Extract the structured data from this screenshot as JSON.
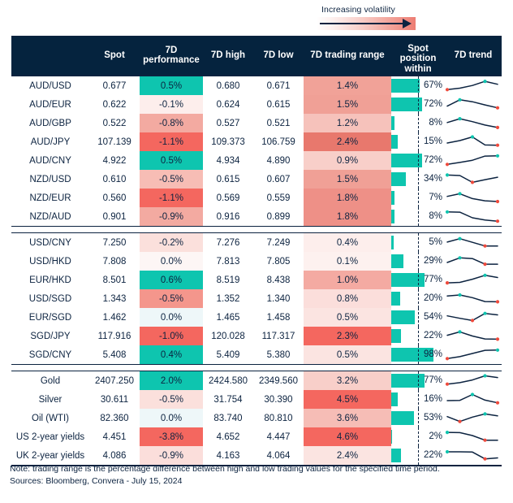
{
  "legend": {
    "volatility_label": "Increasing volatility",
    "gradient_from": "#ffffff",
    "gradient_to": "#ed7d73"
  },
  "colors": {
    "header_bg": "#05233E",
    "text": "#0c2340",
    "teal": "#0ec5af",
    "red_strong": "#f4675f",
    "grid_line": "#0c2340"
  },
  "header": {
    "blank": "",
    "columns": [
      "Spot",
      "7D performance",
      "7D high",
      "7D low",
      "7D trading range",
      "Spot position within range",
      "7D trend"
    ]
  },
  "sections": [
    {
      "name": "antipodean-pairs",
      "rows": [
        {
          "label": "AUD/USD",
          "spot": "0.677",
          "perf": "0.5%",
          "perf_val": 0.5,
          "perf_bg": "#0ec5af",
          "high": "0.680",
          "low": "0.671",
          "range": "1.4%",
          "range_bg": "#f1a298",
          "pos": "67%",
          "pos_val": 67,
          "spark": [
            0.18,
            0.3,
            0.52,
            0.86,
            0.62
          ],
          "spark_start": "low",
          "spark_peak_index": 3
        },
        {
          "label": "AUD/EUR",
          "spot": "0.622",
          "perf": "-0.1%",
          "perf_val": -0.1,
          "perf_bg": "#fdeeec",
          "high": "0.624",
          "low": "0.615",
          "range": "1.5%",
          "range_bg": "#f0a096",
          "pos": "72%",
          "pos_val": 72,
          "spark": [
            0.36,
            0.88,
            0.72,
            0.46,
            0.22
          ],
          "spark_start": "high",
          "spark_peak_index": 1
        },
        {
          "label": "AUD/GBP",
          "spot": "0.522",
          "perf": "-0.8%",
          "perf_val": -0.8,
          "perf_bg": "#f3aaa1",
          "high": "0.527",
          "low": "0.521",
          "range": "1.2%",
          "range_bg": "#f6c2bb",
          "pos": "8%",
          "pos_val": 8,
          "spark": [
            0.55,
            0.86,
            0.62,
            0.34,
            0.14
          ],
          "spark_start": "high",
          "spark_peak_index": 1
        },
        {
          "label": "AUD/JPY",
          "spot": "107.139",
          "perf": "-1.1%",
          "perf_val": -1.1,
          "perf_bg": "#f4675f",
          "high": "109.373",
          "low": "106.759",
          "range": "2.4%",
          "range_bg": "#e8786d",
          "pos": "15%",
          "pos_val": 15,
          "spark": [
            0.4,
            0.6,
            0.9,
            0.24,
            0.22
          ],
          "spark_start": "mid",
          "spark_peak_index": 2
        },
        {
          "label": "AUD/CNY",
          "spot": "4.922",
          "perf": "0.5%",
          "perf_val": 0.5,
          "perf_bg": "#0ec5af",
          "high": "4.934",
          "low": "4.890",
          "range": "0.9%",
          "range_bg": "#f8cfc9",
          "pos": "72%",
          "pos_val": 72,
          "spark": [
            0.18,
            0.34,
            0.52,
            0.86,
            0.88
          ],
          "spark_start": "low",
          "spark_peak_index": 4
        },
        {
          "label": "NZD/USD",
          "spot": "0.610",
          "perf": "-0.5%",
          "perf_val": -0.5,
          "perf_bg": "#f7bdb5",
          "high": "0.615",
          "low": "0.607",
          "range": "1.5%",
          "range_bg": "#f0a096",
          "pos": "34%",
          "pos_val": 34,
          "spark": [
            0.84,
            0.8,
            0.24,
            0.46,
            0.66
          ],
          "spark_start": "high",
          "spark_peak_index": 0
        },
        {
          "label": "NZD/EUR",
          "spot": "0.560",
          "perf": "-1.1%",
          "perf_val": -1.1,
          "perf_bg": "#f4675f",
          "high": "0.569",
          "low": "0.559",
          "range": "1.8%",
          "range_bg": "#ee9087",
          "pos": "7%",
          "pos_val": 7,
          "spark": [
            0.62,
            0.84,
            0.44,
            0.26,
            0.2
          ],
          "spark_start": "high",
          "spark_peak_index": 1
        },
        {
          "label": "NZD/AUD",
          "spot": "0.901",
          "perf": "-0.9%",
          "perf_val": -0.9,
          "perf_bg": "#f3aaa1",
          "high": "0.916",
          "low": "0.899",
          "range": "1.8%",
          "range_bg": "#ee9087",
          "pos": "8%",
          "pos_val": 8,
          "spark": [
            0.88,
            0.86,
            0.4,
            0.22,
            0.12
          ],
          "spark_start": "high",
          "spark_peak_index": 0
        }
      ]
    },
    {
      "name": "asian-pairs",
      "rows": [
        {
          "label": "USD/CNY",
          "spot": "7.250",
          "perf": "-0.2%",
          "perf_val": -0.2,
          "perf_bg": "#fbe0dc",
          "high": "7.276",
          "low": "7.249",
          "range": "0.4%",
          "range_bg": "#fdeeec",
          "pos": "5%",
          "pos_val": 5,
          "spark": [
            0.54,
            0.82,
            0.52,
            0.22,
            0.22
          ],
          "spark_start": "mid",
          "spark_peak_index": 1
        },
        {
          "label": "USD/HKD",
          "spot": "7.808",
          "perf": "0.0%",
          "perf_val": 0.0,
          "perf_bg": "#fdf6f5",
          "high": "7.813",
          "low": "7.805",
          "range": "0.1%",
          "range_bg": "#fdf1ef",
          "pos": "29%",
          "pos_val": 29,
          "spark": [
            0.4,
            0.78,
            0.72,
            0.26,
            0.26
          ],
          "spark_start": "mid",
          "spark_peak_index": 1
        },
        {
          "label": "EUR/HKD",
          "spot": "8.501",
          "perf": "0.6%",
          "perf_val": 0.6,
          "perf_bg": "#0ec5af",
          "high": "8.519",
          "low": "8.438",
          "range": "1.0%",
          "range_bg": "#f4aaa2",
          "pos": "77%",
          "pos_val": 77,
          "spark": [
            0.26,
            0.3,
            0.56,
            0.88,
            0.7
          ],
          "spark_start": "low",
          "spark_peak_index": 3
        },
        {
          "label": "USD/SGD",
          "spot": "1.343",
          "perf": "-0.5%",
          "perf_val": -0.5,
          "perf_bg": "#f4968c",
          "high": "1.352",
          "low": "1.340",
          "range": "0.8%",
          "range_bg": "#fbdedb",
          "pos": "20%",
          "pos_val": 20,
          "spark": [
            0.72,
            0.8,
            0.58,
            0.26,
            0.24
          ],
          "spark_start": "high",
          "spark_peak_index": 1
        },
        {
          "label": "EUR/SGD",
          "spot": "1.462",
          "perf": "0.0%",
          "perf_val": 0.0,
          "perf_bg": "#eef7f9",
          "high": "1.465",
          "low": "1.458",
          "range": "0.5%",
          "range_bg": "#fbe4e1",
          "pos": "54%",
          "pos_val": 54,
          "spark": [
            0.62,
            0.42,
            0.24,
            0.82,
            0.7
          ],
          "spark_start": "mid",
          "spark_peak_index": 3
        },
        {
          "label": "SGD/JPY",
          "spot": "117.916",
          "perf": "-1.0%",
          "perf_val": -1.0,
          "perf_bg": "#f4675f",
          "high": "120.028",
          "low": "117.317",
          "range": "2.3%",
          "range_bg": "#f4675f",
          "pos": "22%",
          "pos_val": 22,
          "spark": [
            0.56,
            0.84,
            0.5,
            0.26,
            0.24
          ],
          "spark_start": "mid",
          "spark_peak_index": 1
        },
        {
          "label": "SGD/CNY",
          "spot": "5.408",
          "perf": "0.4%",
          "perf_val": 0.4,
          "perf_bg": "#0ec5af",
          "high": "5.409",
          "low": "5.380",
          "range": "0.5%",
          "range_bg": "#fbe4e1",
          "pos": "98%",
          "pos_val": 98,
          "spark": [
            0.18,
            0.34,
            0.6,
            0.86,
            0.88
          ],
          "spark_start": "low",
          "spark_peak_index": 4
        }
      ]
    },
    {
      "name": "commodities-and-yields",
      "rows": [
        {
          "label": "Gold",
          "spot": "2407.250",
          "perf": "2.0%",
          "perf_val": 2.0,
          "perf_bg": "#0ec5af",
          "high": "2424.580",
          "low": "2349.560",
          "range": "3.2%",
          "range_bg": "#f8cfc9",
          "pos": "77%",
          "pos_val": 77,
          "spark": [
            0.22,
            0.34,
            0.56,
            0.9,
            0.76
          ],
          "spark_start": "low",
          "spark_peak_index": 3
        },
        {
          "label": "Silver",
          "spot": "30.611",
          "perf": "-0.5%",
          "perf_val": -0.5,
          "perf_bg": "#fbe0dc",
          "high": "31.754",
          "low": "30.390",
          "range": "4.5%",
          "range_bg": "#f4675f",
          "pos": "16%",
          "pos_val": 16,
          "spark": [
            0.4,
            0.42,
            0.9,
            0.44,
            0.22
          ],
          "spark_start": "mid",
          "spark_peak_index": 2
        },
        {
          "label": "Oil (WTI)",
          "spot": "82.360",
          "perf": "0.0%",
          "perf_val": 0.0,
          "perf_bg": "#eef7f9",
          "high": "83.740",
          "low": "80.810",
          "range": "3.6%",
          "range_bg": "#f6bdb6",
          "pos": "53%",
          "pos_val": 53,
          "spark": [
            0.62,
            0.22,
            0.58,
            0.84,
            0.68
          ],
          "spark_start": "mid",
          "spark_peak_index": 3
        },
        {
          "label": "US 2-year yields",
          "spot": "4.451",
          "perf": "-3.8%",
          "perf_val": -3.8,
          "perf_bg": "#f4675f",
          "high": "4.652",
          "low": "4.447",
          "range": "4.6%",
          "range_bg": "#f4675f",
          "pos": "2%",
          "pos_val": 2,
          "spark": [
            0.86,
            0.84,
            0.6,
            0.22,
            0.22
          ],
          "spark_start": "high",
          "spark_peak_index": 0
        },
        {
          "label": "UK 2-year yields",
          "spot": "4.086",
          "perf": "-0.9%",
          "perf_val": -0.9,
          "perf_bg": "#fbdedb",
          "high": "4.163",
          "low": "4.064",
          "range": "2.4%",
          "range_bg": "#fbe4e1",
          "pos": "22%",
          "pos_val": 22,
          "spark": [
            0.8,
            0.8,
            0.78,
            0.22,
            0.3
          ],
          "spark_start": "high",
          "spark_peak_index": 0
        }
      ]
    }
  ],
  "notes": {
    "line1": "Note: trading range is the percentage difference between high and low trading values for the specified time period.",
    "line2": "Sources: Bloomberg, Convera - July 15, 2024"
  }
}
